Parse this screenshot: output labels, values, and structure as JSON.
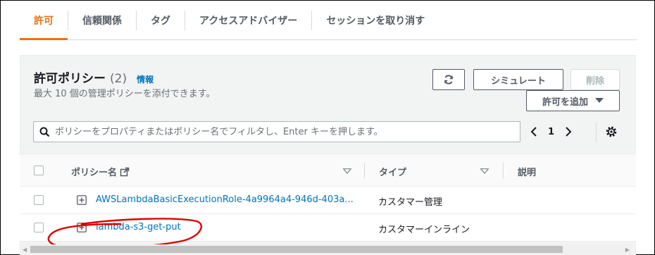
{
  "tabs": [
    {
      "label": "許可",
      "active": true
    },
    {
      "label": "信頼関係"
    },
    {
      "label": "タグ"
    },
    {
      "label": "アクセスアドバイザー"
    },
    {
      "label": "セッションを取り消す"
    }
  ],
  "panel": {
    "title": "許可ポリシー",
    "count": "(2)",
    "info": "情報",
    "desc": "最大 10 個の管理ポリシーを添付できます。"
  },
  "buttons": {
    "simulate": "シミュレート",
    "delete": "削除",
    "add": "許可を追加"
  },
  "search": {
    "placeholder": "ポリシーをプロパティまたはポリシー名でフィルタし、Enter キーを押します。"
  },
  "pager": {
    "page": "1"
  },
  "table": {
    "headers": {
      "name": "ポリシー名",
      "type": "タイプ",
      "desc": "説明"
    },
    "rows": [
      {
        "name": "AWSLambdaBasicExecutionRole-4a9964a4-946d-403a...",
        "type": "カスタマー管理"
      },
      {
        "name": "lambda-s3-get-put",
        "type": "カスタマーインライン"
      }
    ]
  },
  "colors": {
    "accent": "#ec7211",
    "link": "#0073bb",
    "annotation": "#e00000"
  }
}
